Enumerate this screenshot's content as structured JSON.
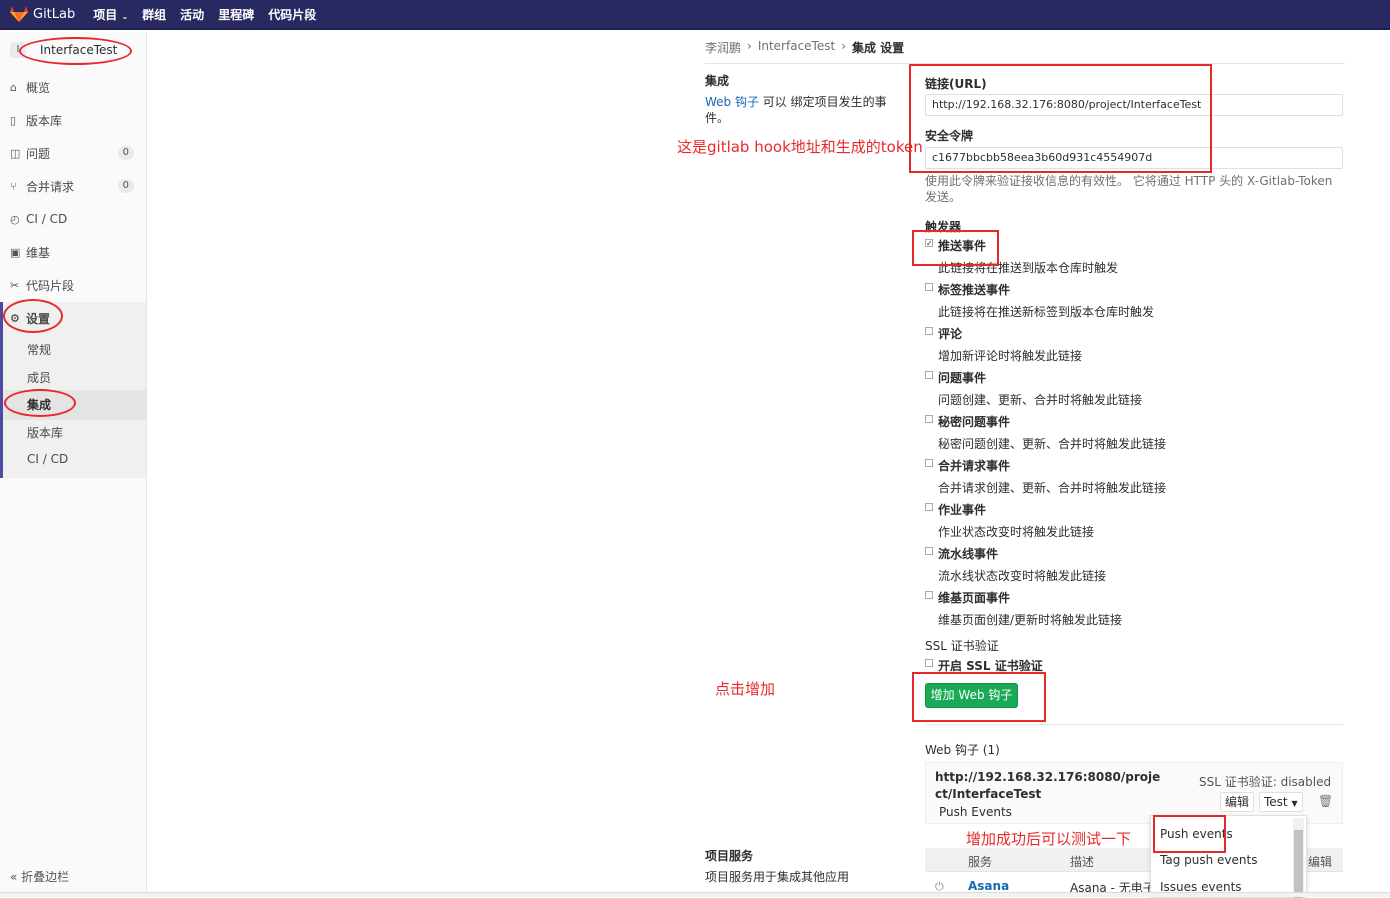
{
  "topbar": {
    "logo_text": "GitLab",
    "nav": [
      "项目",
      "群组",
      "活动",
      "里程碑",
      "代码片段"
    ]
  },
  "sidebar": {
    "project_initial": "I",
    "project_name": "InterfaceTest",
    "items": [
      {
        "icon": "home-icon",
        "label": "概览"
      },
      {
        "icon": "doc-icon",
        "label": "版本库"
      },
      {
        "icon": "issues-icon",
        "label": "问题",
        "count": "0"
      },
      {
        "icon": "merge-icon",
        "label": "合并请求",
        "count": "0"
      },
      {
        "icon": "ci-icon",
        "label": "CI / CD"
      },
      {
        "icon": "book-icon",
        "label": "维基"
      },
      {
        "icon": "scissors-icon",
        "label": "代码片段"
      }
    ],
    "settings_label": "设置",
    "settings_sub": [
      "常规",
      "成员",
      "集成",
      "版本库",
      "CI / CD"
    ],
    "collapse_label": "折叠边栏"
  },
  "breadcrumb": [
    "李润鹏",
    "InterfaceTest",
    "集成 设置"
  ],
  "integration": {
    "title": "集成",
    "desc_link": "Web 钩子",
    "desc_text": " 可以 绑定项目发生的事件。",
    "url_label": "链接(URL)",
    "url_value": "http://192.168.32.176:8080/project/InterfaceTest",
    "token_label": "安全令牌",
    "token_value": "c1677bbcbb58eea3b60d931c4554907d",
    "token_hint": "使用此令牌来验证接收信息的有效性。 它将通过 HTTP 头的 X-Gitlab-Token 发送。",
    "triggers_label": "触发器",
    "triggers": [
      {
        "name": "推送事件",
        "desc": "此链接将在推送到版本仓库时触发",
        "checked": true
      },
      {
        "name": "标签推送事件",
        "desc": "此链接将在推送新标签到版本仓库时触发",
        "checked": false
      },
      {
        "name": "评论",
        "desc": "增加新评论时将触发此链接",
        "checked": false
      },
      {
        "name": "问题事件",
        "desc": "问题创建、更新、合并时将触发此链接",
        "checked": false
      },
      {
        "name": "秘密问题事件",
        "desc": "秘密问题创建、更新、合并时将触发此链接",
        "checked": false
      },
      {
        "name": "合并请求事件",
        "desc": "合并请求创建、更新、合并时将触发此链接",
        "checked": false
      },
      {
        "name": "作业事件",
        "desc": "作业状态改变时将触发此链接",
        "checked": false
      },
      {
        "name": "流水线事件",
        "desc": "流水线状态改变时将触发此链接",
        "checked": false
      },
      {
        "name": "维基页面事件",
        "desc": "维基页面创建/更新时将触发此链接",
        "checked": false
      }
    ],
    "ssl_label": "SSL 证书验证",
    "ssl_check_label": "开启 SSL 证书验证",
    "add_button": "增加 Web 钩子"
  },
  "webhooks": {
    "title": "Web 钩子 (1)",
    "url": "http://192.168.32.176:8080/project/InterfaceTest",
    "events": "Push Events",
    "ssl_status": "SSL 证书验证:  disabled",
    "edit_label": "编辑",
    "test_label": "Test",
    "dropdown": [
      "Push events",
      "Tag push events",
      "Issues events"
    ]
  },
  "services": {
    "title": "项目服务",
    "desc": "项目服务用于集成其他应用",
    "col_service": "服务",
    "col_desc": "描述",
    "col_edit": "编辑",
    "row_name": "Asana",
    "row_desc": "Asana - 无电子"
  },
  "annotations": {
    "hook_note": "这是gitlab hook地址和生成的token",
    "click_note": "点击增加",
    "test_note": "增加成功后可以测试一下"
  },
  "colors": {
    "topbar": "#292961",
    "accent_red": "#e8292b",
    "btn_green": "#1aaa55",
    "link_blue": "#1b69b6"
  }
}
